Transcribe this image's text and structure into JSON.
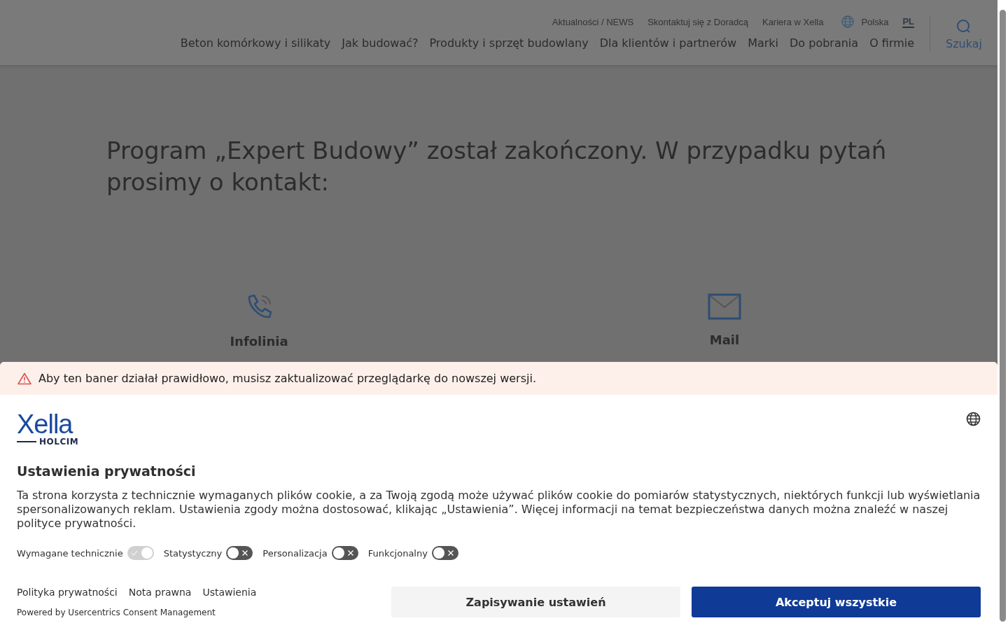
{
  "header": {
    "top_links": [
      "Aktualności / NEWS",
      "Skontaktuj się z Doradcą",
      "Kariera w Xella"
    ],
    "region": "Polska",
    "languages": [
      {
        "label": "PL",
        "selected": true
      }
    ],
    "nav": [
      "Beton komórkowy i silikaty",
      "Jak budować?",
      "Produkty i sprzęt budowlany",
      "Dla klientów i partnerów",
      "Marki",
      "Do pobrania",
      "O firmie"
    ],
    "search": "Szukaj"
  },
  "heading": "Program „Expert Budowy” został zakończony. W przypadku pytań prosimy o kontakt:",
  "contacts": [
    {
      "kind": "phone",
      "title": "Infolinia"
    },
    {
      "kind": "mail",
      "title": "Mail"
    }
  ],
  "consent": {
    "warning": "Aby ten baner działał prawidłowo, musisz zaktualizować przeglądarkę do nowszej wersji.",
    "logo": {
      "brand": "Xella",
      "sub": "HOLCIM"
    },
    "title": "Ustawienia prywatności",
    "description": "Ta strona korzysta z technicznie wymaganych plików cookie, a za Twoją zgodą może używać plików cookie do pomiarów statystycznych, niektórych funkcji lub wyświetlania spersonalizowanych reklam. Ustawienia zgody można dostosować, klikając „Ustawienia”. Więcej informacji na temat bezpieczeństwa danych można znaleźć w naszej polityce prywatności.",
    "toggles": [
      {
        "label": "Wymagane technicznie",
        "checked": true,
        "disabled": true
      },
      {
        "label": "Statystyczny",
        "checked": false,
        "disabled": false
      },
      {
        "label": "Personalizacja",
        "checked": false,
        "disabled": false
      },
      {
        "label": "Funkcjonalny",
        "checked": false,
        "disabled": false
      }
    ],
    "links": [
      "Polityka prywatności",
      "Nota prawna",
      "Ustawienia"
    ],
    "powered": "Powered by Usercentrics Consent Management",
    "buttons": [
      {
        "label": "Zapisywanie ustawień",
        "kind": "secondary"
      },
      {
        "label": "Akceptuj wszystkie",
        "kind": "primary"
      }
    ]
  }
}
